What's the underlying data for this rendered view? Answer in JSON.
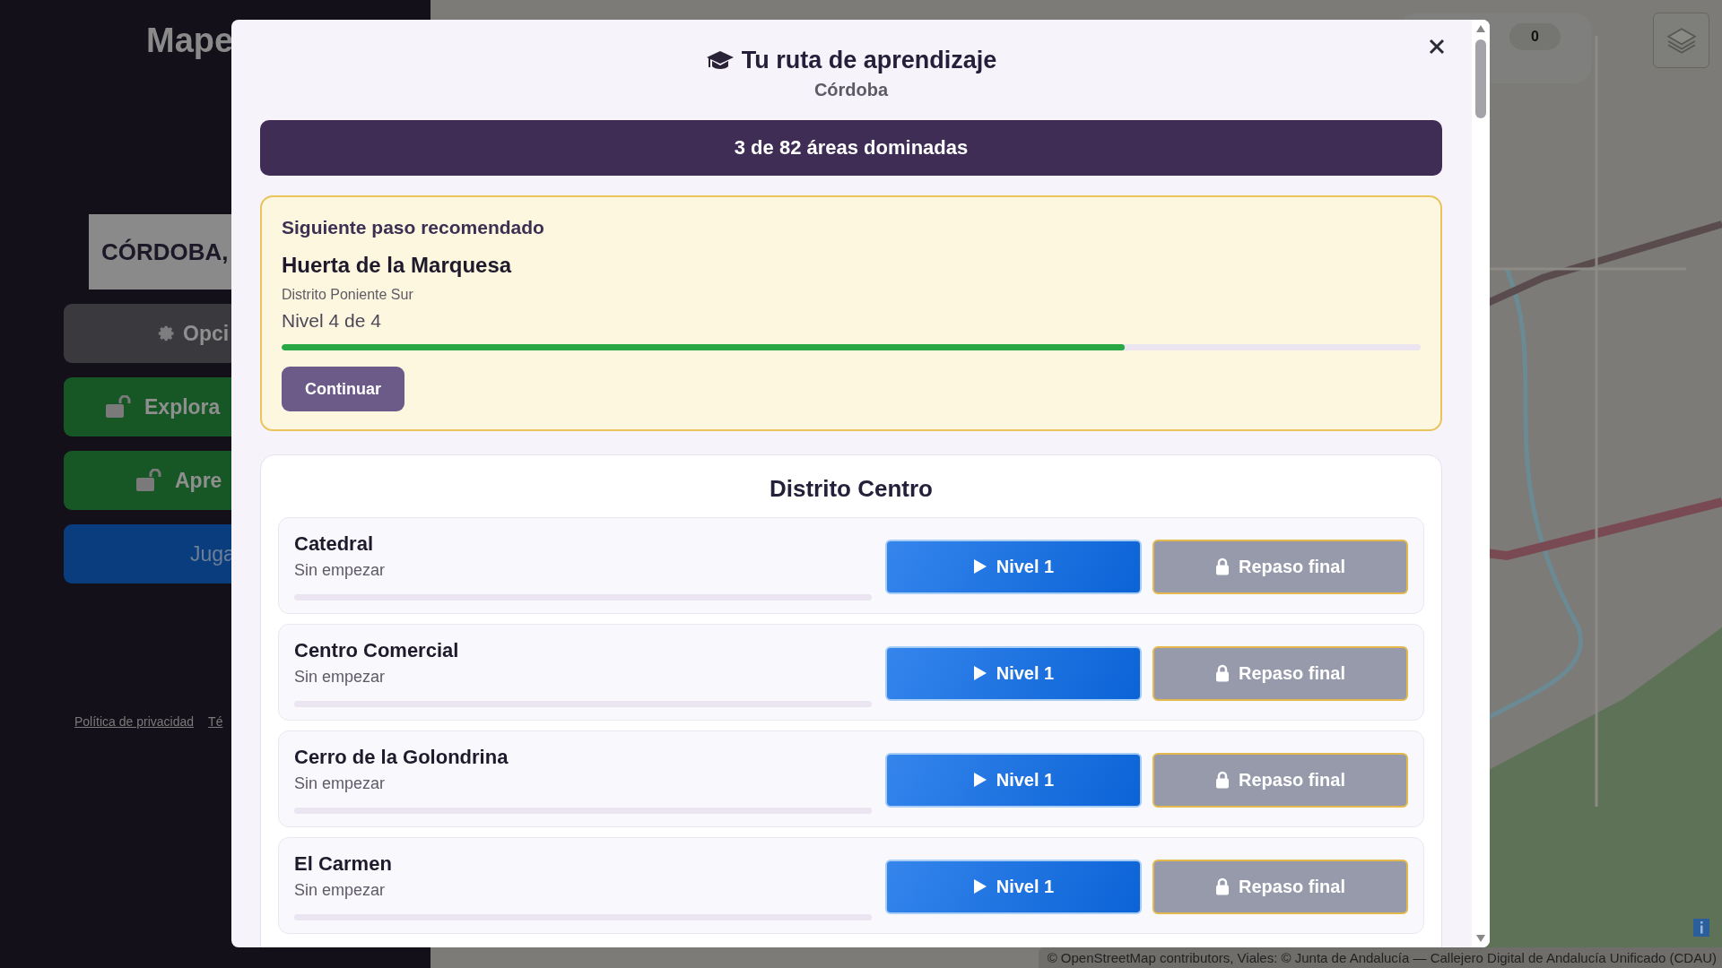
{
  "sidebar": {
    "title": "Mape",
    "city": "CÓRDOBA,",
    "buttons": [
      {
        "label": "Opci",
        "kind": "options"
      },
      {
        "label": "Explora",
        "kind": "explore"
      },
      {
        "label": "Apre",
        "kind": "learn"
      },
      {
        "label": "Juga",
        "kind": "play"
      }
    ],
    "footer_links": [
      "Política de privacidad",
      "Té"
    ]
  },
  "map": {
    "score": "0",
    "attribution": "© OpenStreetMap contributors, Viales: © Junta de Andalucía — Callejero Digital de Andalucía Unificado (CDAU)"
  },
  "modal": {
    "title": "Tu ruta de aprendizaje",
    "subtitle": "Córdoba",
    "summary": "3 de 82 áreas dominadas",
    "recommended": {
      "heading": "Siguiente paso recomendado",
      "area": "Huerta de la Marquesa",
      "district": "Distrito Poniente Sur",
      "level_text": "Nivel 4 de 4",
      "level": 0.74,
      "button": "Continuar"
    },
    "section": {
      "title": "Distrito Centro",
      "areas": [
        {
          "name": "Catedral",
          "status": "Sin empezar",
          "play_button": "Nivel 1",
          "review_button": "Repaso final",
          "review_locked": true
        },
        {
          "name": "Centro Comercial",
          "status": "Sin empezar",
          "play_button": "Nivel 1",
          "review_button": "Repaso final",
          "review_locked": true
        },
        {
          "name": "Cerro de la Golondrina",
          "status": "Sin empezar",
          "play_button": "Nivel 1",
          "review_button": "Repaso final",
          "review_locked": true
        },
        {
          "name": "El Carmen",
          "status": "Sin empezar",
          "play_button": "Nivel 1",
          "review_button": "Repaso final",
          "review_locked": true
        }
      ]
    }
  }
}
